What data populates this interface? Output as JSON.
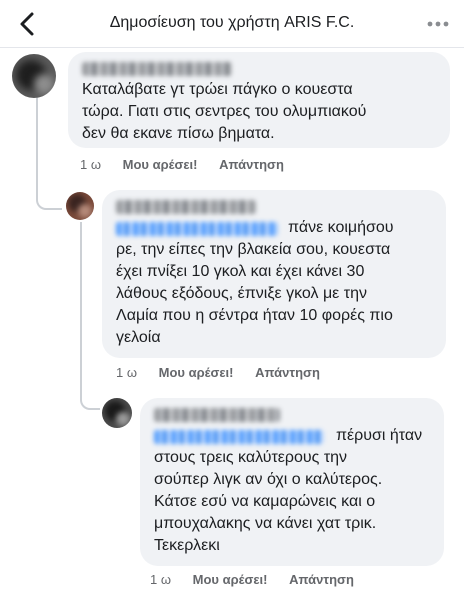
{
  "header": {
    "title": "Δημοσίευση του χρήστη ARIS F.C."
  },
  "comments": [
    {
      "text_lines": [
        "Καταλάβατε γτ τρώει πάγκο ο κουεστα",
        "τώρα. Γιατι στις σεντρες του ολυμπιακού",
        "δεν θα εκανε πίσω βηματα."
      ],
      "time": "1 ω",
      "like_label": "Μου αρέσει!",
      "reply_label": "Απάντηση"
    },
    {
      "first_line_text": "πάνε κοιμήσου",
      "text_lines": [
        "ρε, την είπες την βλακεία σου, κουεστα",
        "έχει πνίξει 10 γκολ και έχει κάνει 30",
        "λάθους εξόδους, έπνιξε γκολ με την",
        "Λαμία που η σέντρα ήταν 10 φορές πιο",
        "γελοία"
      ],
      "time": "1 ω",
      "like_label": "Μου αρέσει!",
      "reply_label": "Απάντηση"
    },
    {
      "first_line_text": "πέρυσι ήταν",
      "text_lines": [
        "στους τρεις καλύτερους την",
        "σούπερ λιγκ αν όχι ο καλύτερος.",
        "Κάτσε εσύ να καμαρώνεις και ο",
        "μπουχαλακης να κάνει χατ τρικ.",
        "Τεκερλεκι"
      ],
      "time": "1 ω",
      "like_label": "Μου αρέσει!",
      "reply_label": "Απάντηση"
    }
  ],
  "colors": {
    "bubble": "#f0f2f5",
    "link": "#1877f2",
    "meta_text": "#65676b"
  },
  "icons": {
    "back": "chevron-left-icon",
    "more": "more-horizontal-icon"
  }
}
